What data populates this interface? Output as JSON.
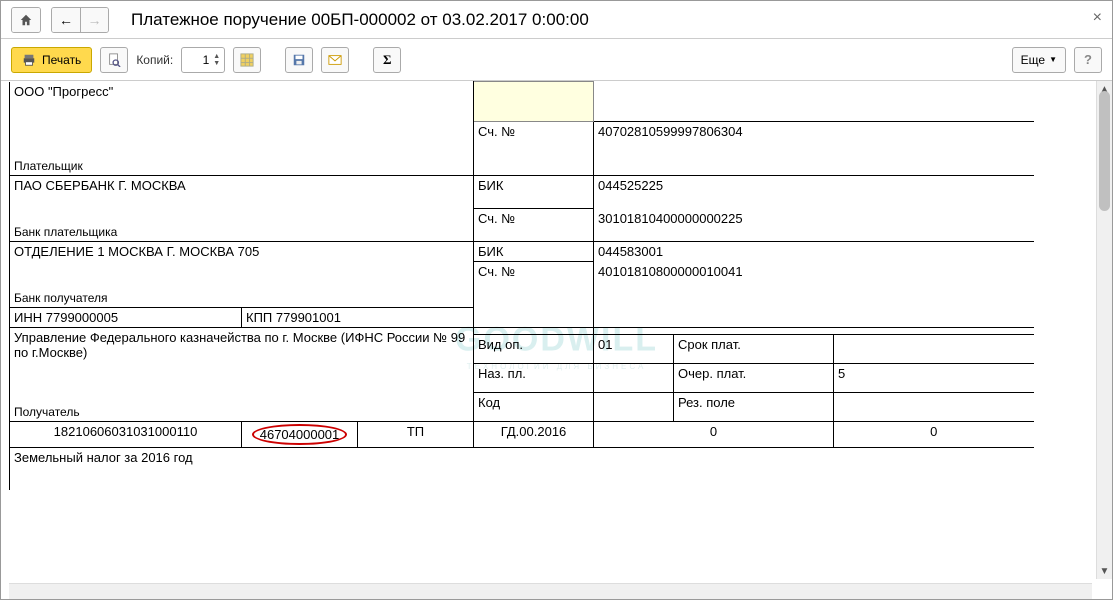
{
  "window": {
    "title": "Платежное поручение 00БП-000002 от 03.02.2017 0:00:00"
  },
  "toolbar": {
    "print_label": "Печать",
    "copies_label": "Копий:",
    "copies_value": "1",
    "more_label": "Еще"
  },
  "doc": {
    "payer_name": "ООО \"Прогресс\"",
    "payer_label": "Плательщик",
    "payer_account_label": "Сч. №",
    "payer_account": "40702810599997806304",
    "payer_bank": "ПАО СБЕРБАНК Г. МОСКВА",
    "payer_bank_label": "Банк плательщика",
    "bik_label": "БИК",
    "payer_bik": "044525225",
    "payer_bank_account": "30101810400000000225",
    "recipient_bank": "ОТДЕЛЕНИЕ 1 МОСКВА Г. МОСКВА 705",
    "recipient_bank_label": "Банк получателя",
    "recipient_bik": "044583001",
    "recipient_bank_account": "40101810800000010041",
    "inn_label": "ИНН",
    "inn": "7799000005",
    "kpp_label": "КПП",
    "kpp": "779901001",
    "recipient_name": "Управление Федерального казначейства по г. Москве (ИФНС России № 99 по г.Москве)",
    "recipient_label": "Получатель",
    "vid_op_label": "Вид оп.",
    "vid_op": "01",
    "srok_plat_label": "Срок плат.",
    "naz_pl_label": "Наз. пл.",
    "ocher_plat_label": "Очер. плат.",
    "ocher_plat": "5",
    "kod_label": "Код",
    "rez_pole_label": "Рез. поле",
    "kbk": "18210606031031000110",
    "oktmo": "46704000001",
    "basis": "ТП",
    "period": "ГД.00.2016",
    "zero1": "0",
    "zero2": "0",
    "purpose": "Земельный налог за 2016 год"
  },
  "watermark": {
    "main": "GOODWILL",
    "sub": "ТЕХНОЛОГИИ ДЛЯ БИЗНЕСА"
  }
}
